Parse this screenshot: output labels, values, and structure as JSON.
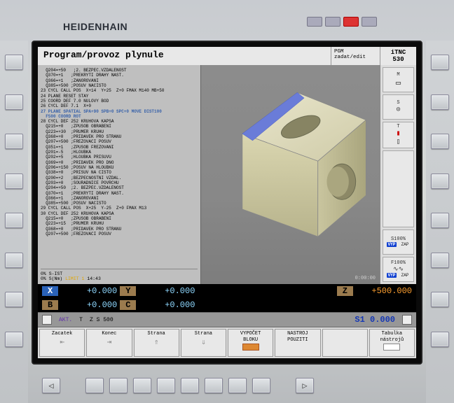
{
  "brand": "HEIDENHAIN",
  "title": "Program/provoz plynule",
  "mode": {
    "line1": "PGM",
    "line2": "zadat/edit"
  },
  "model": "iTNC 530",
  "code_lines": [
    "  Q204=+50   ;2. BEZPEC.VZDALENOST",
    "  Q370=+1   ;PREKRYTI DRAHY NAST.",
    "  Q366=+1   ;ZANOROVANI",
    "  Q385=+500 ;POSUV NACISTO",
    "23 CYCL CALL POS  X+14  Y+25  Z+0 FMAX M140 MB+50",
    "24 PLANE RESET STAY",
    "25 COORD DEF 7.0 NULOVY BOD",
    "26 CYCL DEF 7.1  X+0",
    "27 PLANE SPATIAL SPA+90 SPB+0 SPC+0 MOVE DIST100",
    "  F500 COORD ROT",
    "28 CYCL DEF 252 KRUHOVA KAPSA",
    "  Q215=+0   ;ZPUSOB OBRABENI",
    "  Q223=+30  ;PRUMER KRUHU",
    "  Q368=+0   ;PRIDAVEK PRO STRANU",
    "  Q207=+500 ;FREZOVACI POSUV",
    "  Q351=+1   ;ZPUSOB FREZOVANI",
    "  Q201=-5   ;HLOUBKA",
    "  Q202=+5   ;HLOUBKA PRISUVU",
    "  Q369=+0   ;PRIDAVEK PRO DNO",
    "  Q206=+150 ;POSUV NA HLOUBKU",
    "  Q338=+0   ;PRISUV NA CISTO",
    "  Q200=+2   ;BEZPECNOSTNI VZDAL.",
    "  Q203=+0   ;SOURADNICE POVRCHU",
    "  Q204=+50  ;2. BEZPEC.VZDALENOST",
    "  Q370=+1   ;PREKRYTI DRAHY NAST.",
    "  Q366=+1   ;ZANOROVANI",
    "  Q385=+500 ;POSUV NACISTO",
    "29 CYCL CALL POS  X+25  Y-25  Z+0 FMAX M13",
    "30 CYCL DEF 252 KRUHOVA KAPSA",
    "  Q215=+0   ;ZPUSOB OBRABENI",
    "  Q223=+15  ;PRUMER KRUHU",
    "  Q368=+0   ;PRIDAVEK PRO STRANU",
    "  Q207=+500 ;FREZOVACI POSUV"
  ],
  "highlight_indices": [
    8,
    9
  ],
  "footer": {
    "sist": "0% S-IST",
    "snml": "0% S(Nm)",
    "limit": "LIMIT 1",
    "time": "14:43"
  },
  "viewport_time": "0:00:00",
  "axes_top": {
    "x": "+0.000",
    "y": "+0.000",
    "z": "+500.000",
    "xlbl": "X",
    "ylbl": "Y",
    "zlbl": "Z"
  },
  "axes_bot": {
    "b": "+0.000",
    "c": "+0.000",
    "blbl": "B",
    "clbl": "C"
  },
  "info": {
    "akt": "AKT.",
    "t": "T",
    "z5": "Z S 500",
    "s1": "S1   0.000"
  },
  "side": {
    "m": "M",
    "s": "S",
    "t": "T",
    "s100": "S100%",
    "vyp": "VYP",
    "zap": "ZAP",
    "f100": "F100%"
  },
  "softkeys": {
    "k1": "Zacatek",
    "k2": "Konec",
    "k3": "Strana",
    "k4": "Strana",
    "k5a": "VYPOČET",
    "k5b": "BLOKU",
    "k6a": "NASTROJ",
    "k6b": "POUZITI",
    "k7": "",
    "k8a": "Tabulka",
    "k8b": "nástrojů"
  }
}
